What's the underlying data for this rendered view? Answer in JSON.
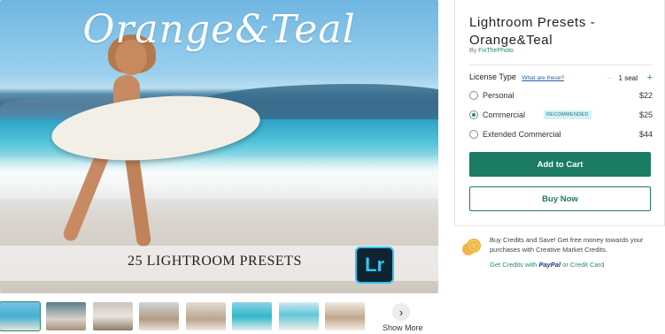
{
  "hero": {
    "title": "Orange&Teal",
    "caption": "25 LIGHTROOM PRESETS",
    "badge": "Lr"
  },
  "thumbnails": {
    "count": 8,
    "show_more_label": "Show More"
  },
  "product": {
    "title": "Lightroom Presets - Orange&Teal",
    "by_prefix": "By",
    "author": "FixThePhoto",
    "license_label": "License Type",
    "license_help": "What are these?",
    "seats": "1 seat",
    "options": [
      {
        "label": "Personal",
        "price": "$22",
        "selected": false
      },
      {
        "label": "Commercial",
        "price": "$25",
        "selected": true,
        "badge": "RECOMMENDED"
      },
      {
        "label": "Extended Commercial",
        "price": "$44",
        "selected": false
      }
    ],
    "add_to_cart": "Add to Cart",
    "buy_now": "Buy Now"
  },
  "credits": {
    "text": "Buy Credits and Save! Get free money towards your purchases with Creative Market Credits.",
    "link_prefix": "Get Credits with",
    "paypal": "PayPal",
    "link_suffix": "or Credit Card"
  },
  "colors": {
    "accent": "#1b7b63",
    "lr_badge_border": "#31c5f4"
  }
}
